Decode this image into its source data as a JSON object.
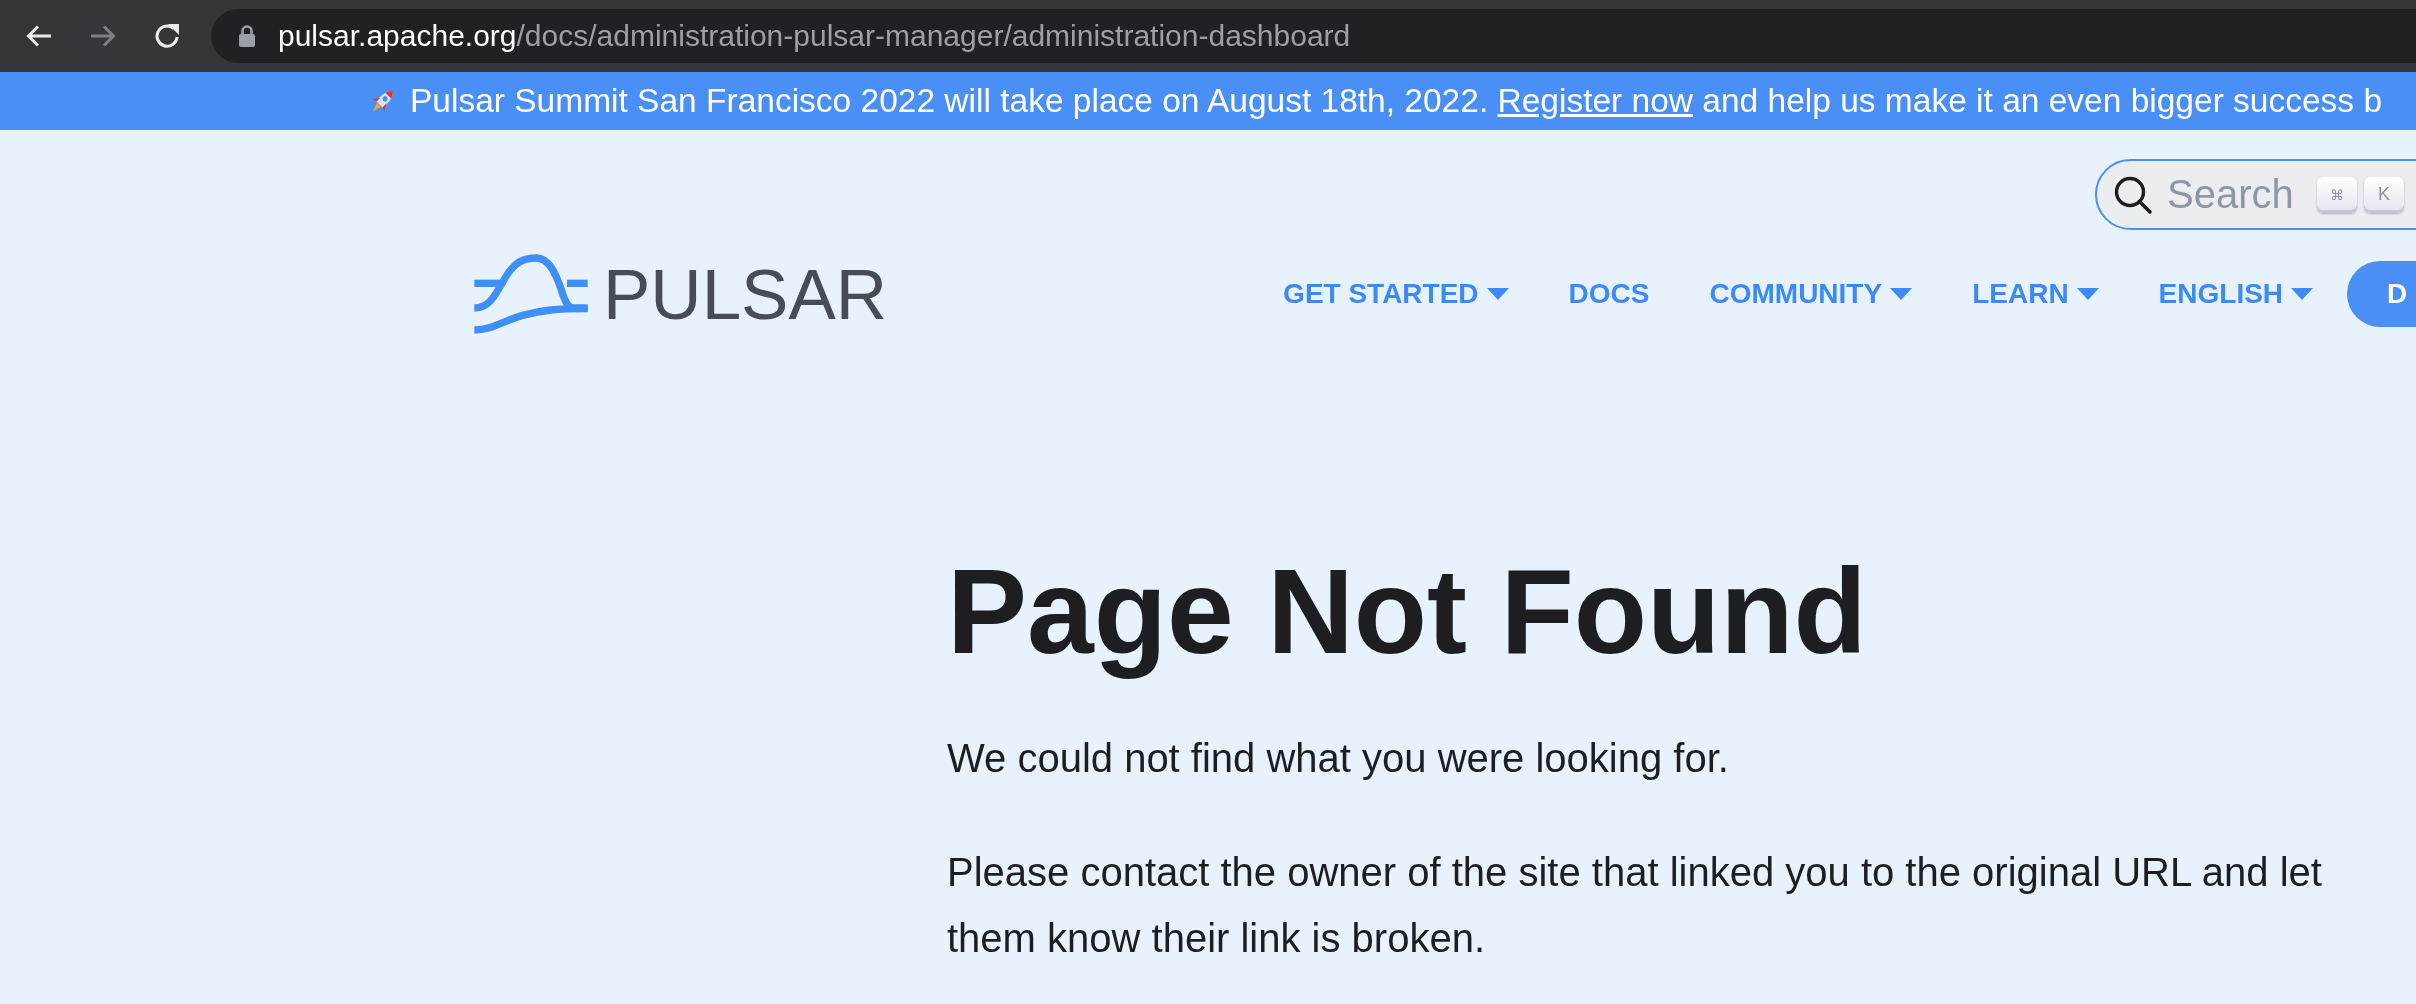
{
  "browser": {
    "nav_buttons": [
      {
        "kind": "back",
        "disabled": false
      },
      {
        "kind": "forward",
        "disabled": true
      },
      {
        "kind": "reload",
        "disabled": false
      }
    ],
    "address": {
      "host": "pulsar.apache.org",
      "path": "/docs/administration-pulsar-manager/administration-dashboard"
    }
  },
  "announcement": {
    "text_before": "Pulsar Summit San Francisco 2022 will take place on August 18th, 2022.",
    "link": "Register now",
    "text_after": "and help us make it an even bigger success b"
  },
  "search": {
    "placeholder": "Search",
    "shortcut_keys": [
      "⌘",
      "K"
    ]
  },
  "header": {
    "logo": "PULSAR",
    "nav": [
      {
        "label": "GET STARTED",
        "kind": "dropdown"
      },
      {
        "label": "DOCS",
        "kind": "link"
      },
      {
        "label": "COMMUNITY",
        "kind": "dropdown"
      },
      {
        "label": "LEARN",
        "kind": "dropdown"
      },
      {
        "label": "ENGLISH",
        "kind": "dropdown"
      },
      {
        "label": "D",
        "kind": "button"
      }
    ]
  },
  "main": {
    "title": "Page Not Found",
    "paragraphs": [
      "We could not find what you were looking for.",
      "Please contact the owner of the site that linked you to the original URL and let them know their link is broken."
    ]
  }
}
